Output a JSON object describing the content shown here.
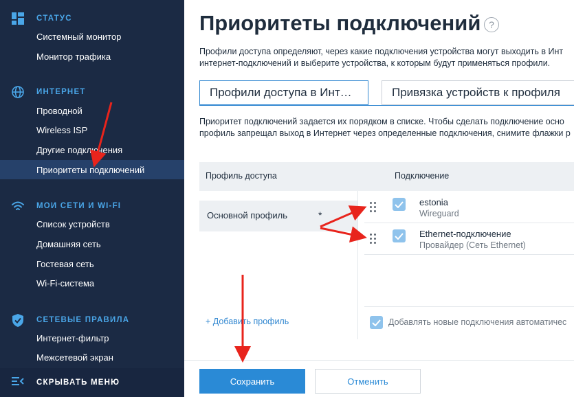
{
  "sidebar": {
    "sections": [
      {
        "title": "СТАТУС",
        "icon": "dashboard-icon",
        "items": [
          "Системный монитор",
          "Монитор трафика"
        ]
      },
      {
        "title": "ИНТЕРНЕТ",
        "icon": "globe-icon",
        "items": [
          "Проводной",
          "Wireless ISP",
          "Другие подключения",
          "Приоритеты подключений"
        ]
      },
      {
        "title": "МОИ СЕТИ И WI-FI",
        "icon": "wifi-icon",
        "items": [
          "Список устройств",
          "Домашняя сеть",
          "Гостевая сеть",
          "Wi-Fi-система"
        ]
      },
      {
        "title": "СЕТЕВЫЕ ПРАВИЛА",
        "icon": "shield-check-icon",
        "items": [
          "Интернет-фильтр",
          "Межсетевой экран"
        ]
      }
    ],
    "active_item": "Приоритеты подключений",
    "footer": {
      "label": "СКРЫВАТЬ МЕНЮ",
      "icon": "collapse-menu-icon"
    }
  },
  "page": {
    "title": "Приоритеты подключений",
    "help_icon": "?",
    "description_line1": "Профили доступа определяют, через какие подключения устройства могут выходить в Инт",
    "description_line2": "интернет-подключений и выберите устройства, к которым будут применяться профили."
  },
  "tabs": [
    {
      "label": "Профили доступа в Инт…",
      "active": true
    },
    {
      "label": "Привязка устройств к профиля",
      "active": false
    }
  ],
  "priority_description_line1": "Приоритет подключений задается их порядком в списке. Чтобы сделать подключение осно",
  "priority_description_line2": "профиль запрещал выход в Интернет через определенные подключения, снимите флажки р",
  "table": {
    "header_profile": "Профиль доступа",
    "header_connection": "Подключение",
    "profile": {
      "name": "Основной профиль",
      "marker": "*"
    },
    "connections": [
      {
        "name": "estonia",
        "type": "Wireguard",
        "checked": true
      },
      {
        "name": "Ethernet-подключение",
        "type": "Провайдер (Сеть Ethernet)",
        "checked": true
      }
    ],
    "add_profile": "+ Добавить профиль",
    "auto_add_label": "Добавлять новые подключения автоматичес"
  },
  "buttons": {
    "save": "Сохранить",
    "cancel": "Отменить"
  },
  "colors": {
    "sidebar_bg": "#1b2a44",
    "sidebar_active": "#26416a",
    "accent": "#2a8ad6",
    "section_title": "#4aa6e8",
    "annotation_arrow": "#e8241c"
  }
}
